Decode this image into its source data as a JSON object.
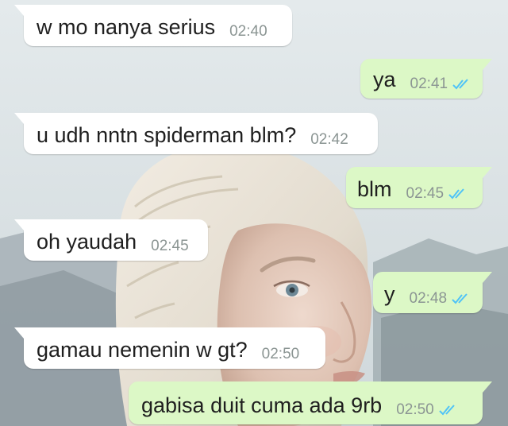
{
  "messages": [
    {
      "direction": "in",
      "text": "w mo nanya serius",
      "time": "02:40"
    },
    {
      "direction": "out",
      "text": "ya",
      "time": "02:41",
      "status": "read"
    },
    {
      "direction": "in",
      "text": "u udh nntn spiderman blm?",
      "time": "02:42"
    },
    {
      "direction": "out",
      "text": "blm",
      "time": "02:45",
      "status": "read"
    },
    {
      "direction": "in",
      "text": "oh yaudah",
      "time": "02:45"
    },
    {
      "direction": "out",
      "text": "y",
      "time": "02:48",
      "status": "read"
    },
    {
      "direction": "in",
      "text": "gamau nemenin w gt?",
      "time": "02:50"
    },
    {
      "direction": "out",
      "text": "gabisa duit cuma ada 9rb",
      "time": "02:50",
      "status": "read"
    }
  ],
  "colors": {
    "incoming_bubble": "#ffffff",
    "outgoing_bubble": "#dcf8c6",
    "read_tick": "#4fc3f7",
    "timestamp": "#8b9593"
  },
  "icons": {
    "read_status": "double-check-icon"
  }
}
